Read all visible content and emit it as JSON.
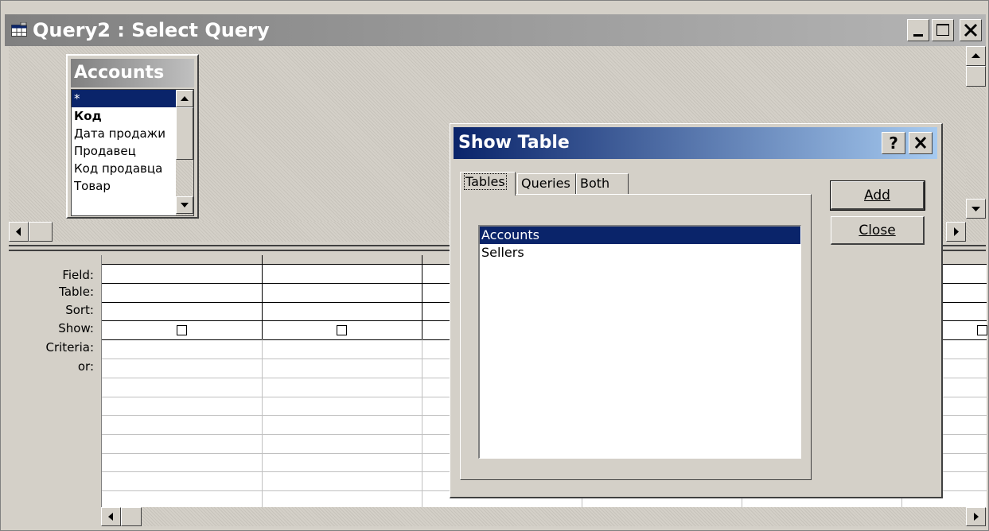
{
  "window": {
    "title": "Query2 : Select Query",
    "icon": "query-icon"
  },
  "table_box": {
    "title": "Accounts",
    "fields": [
      "*",
      "Код",
      "Дата продажи",
      "Продавец",
      "Код продавца",
      "Товар"
    ]
  },
  "grid": {
    "row_labels": [
      "Field:",
      "Table:",
      "Sort:",
      "Show:",
      "Criteria:",
      "or:"
    ]
  },
  "dialog": {
    "title": "Show Table",
    "help_label": "?",
    "close_glyph": "✕",
    "tabs": [
      "Tables",
      "Queries",
      "Both"
    ],
    "tables": [
      "Accounts",
      "Sellers"
    ],
    "add_label": "Add",
    "close_label": "Close"
  }
}
